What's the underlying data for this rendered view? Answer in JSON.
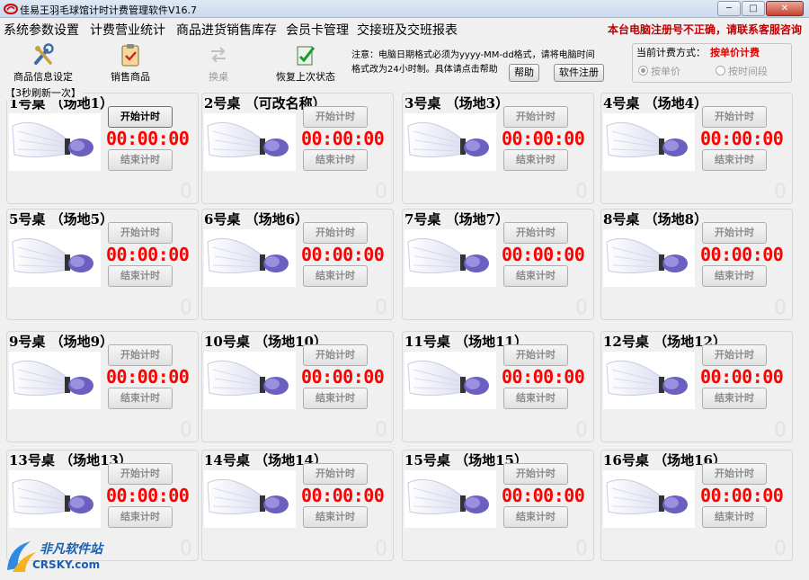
{
  "window": {
    "title": "佳易王羽毛球馆计时计费管理软件V16.7",
    "controls": {
      "minimize": "─",
      "maximize": "□",
      "close": "✕"
    }
  },
  "menu": {
    "items": [
      "系统参数设置",
      "计费营业统计",
      "商品进货销售库存",
      "会员卡管理",
      "交接班及交班报表"
    ],
    "registration_warning": "本台电脑注册号不正确，请联系客服咨询"
  },
  "toolbar": {
    "product_settings": "商品信息设定",
    "sell_product": "销售商品",
    "swap_table": "换桌",
    "restore_status": "恢复上次状态",
    "notice_line1": "注意：电脑日期格式必须为yyyy-MM-dd格式，请将电脑时间",
    "notice_line2": "格式改为24小时制。具体请点击帮助",
    "help_button": "帮助",
    "register_button": "软件注册"
  },
  "billing": {
    "label": "当前计费方式：",
    "mode": "按单价计费",
    "option_unit": "按单价",
    "option_period": "按时间段",
    "selected": "unit"
  },
  "refresh_label": "【3秒刷新一次】",
  "tables": [
    {
      "title": "1号桌  （场地1）",
      "start": "开始计时",
      "timer": "00:00:00",
      "end": "结束计时",
      "count": "0",
      "active": true
    },
    {
      "title": "2号桌  （可改名称）",
      "start": "开始计时",
      "timer": "00:00:00",
      "end": "结束计时",
      "count": "0",
      "active": false
    },
    {
      "title": "3号桌  （场地3）",
      "start": "开始计时",
      "timer": "00:00:00",
      "end": "结束计时",
      "count": "0",
      "active": false
    },
    {
      "title": "4号桌  （场地4）",
      "start": "开始计时",
      "timer": "00:00:00",
      "end": "结束计时",
      "count": "0",
      "active": false
    },
    {
      "title": "5号桌  （场地5）",
      "start": "开始计时",
      "timer": "00:00:00",
      "end": "结束计时",
      "count": "0",
      "active": false
    },
    {
      "title": "6号桌  （场地6）",
      "start": "开始计时",
      "timer": "00:00:00",
      "end": "结束计时",
      "count": "0",
      "active": false
    },
    {
      "title": "7号桌  （场地7）",
      "start": "开始计时",
      "timer": "00:00:00",
      "end": "结束计时",
      "count": "0",
      "active": false
    },
    {
      "title": "8号桌  （场地8）",
      "start": "开始计时",
      "timer": "00:00:00",
      "end": "结束计时",
      "count": "0",
      "active": false
    },
    {
      "title": "9号桌  （场地9）",
      "start": "开始计时",
      "timer": "00:00:00",
      "end": "结束计时",
      "count": "0",
      "active": false
    },
    {
      "title": "10号桌 （场地10）",
      "start": "开始计时",
      "timer": "00:00:00",
      "end": "结束计时",
      "count": "0",
      "active": false
    },
    {
      "title": "11号桌 （场地11）",
      "start": "开始计时",
      "timer": "00:00:00",
      "end": "结束计时",
      "count": "0",
      "active": false
    },
    {
      "title": "12号桌 （场地12）",
      "start": "开始计时",
      "timer": "00:00:00",
      "end": "结束计时",
      "count": "0",
      "active": false
    },
    {
      "title": "13号桌 （场地13）",
      "start": "开始计时",
      "timer": "00:00:00",
      "end": "结束计时",
      "count": "0",
      "active": false
    },
    {
      "title": "14号桌 （场地14）",
      "start": "开始计时",
      "timer": "00:00:00",
      "end": "结束计时",
      "count": "0",
      "active": false
    },
    {
      "title": "15号桌 （场地15）",
      "start": "开始计时",
      "timer": "00:00:00",
      "end": "结束计时",
      "count": "0",
      "active": false
    },
    {
      "title": "16号桌 （场地16）",
      "start": "开始计时",
      "timer": "00:00:00",
      "end": "结束计时",
      "count": "0",
      "active": false
    }
  ],
  "watermark": {
    "name": "非凡软件站",
    "sub": "CRSKY.com"
  },
  "colors": {
    "timer": "#ff0000",
    "warning": "#c00000",
    "billing_mode": "#e00000"
  }
}
